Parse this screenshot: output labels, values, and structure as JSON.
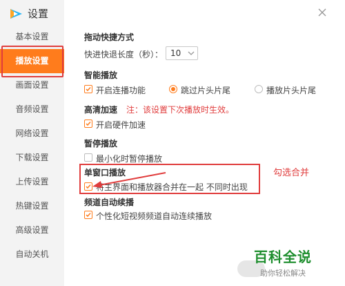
{
  "app": {
    "title": "设置"
  },
  "sidebar": {
    "items": [
      {
        "label": "基本设置"
      },
      {
        "label": "播放设置"
      },
      {
        "label": "画面设置"
      },
      {
        "label": "音频设置"
      },
      {
        "label": "网络设置"
      },
      {
        "label": "下载设置"
      },
      {
        "label": "上传设置"
      },
      {
        "label": "热键设置"
      },
      {
        "label": "高级设置"
      },
      {
        "label": "自动关机"
      }
    ],
    "active_index": 1
  },
  "main": {
    "drag": {
      "title": "拖动快捷方式",
      "seek_label": "快进快退长度（秒）：",
      "seek_value": "10"
    },
    "smart": {
      "title": "智能播放",
      "continuous_label": "开启连播功能",
      "skip_label": "跳过片头片尾",
      "play_label": "播放片头片尾"
    },
    "hd": {
      "title": "高清加速",
      "note": "注：该设置下次播放时生效。",
      "hw_label": "开启硬件加速"
    },
    "pause": {
      "title": "暂停播放",
      "minimize_label": "最小化时暂停播放"
    },
    "single": {
      "title": "单窗口播放",
      "merge_label": "将主界面和播放器合并在一起 不同时出现"
    },
    "channel": {
      "title": "频道自动续播",
      "auto_label": "个性化短视频频道自动连续播放"
    }
  },
  "annotation": {
    "callout": "勾选合并"
  },
  "watermark": {
    "main": "百科全说",
    "sub": "助你轻松解决"
  },
  "colors": {
    "accent": "#ff7c1c",
    "annotation": "#e03c3c",
    "watermark": "#1e8e2e"
  }
}
